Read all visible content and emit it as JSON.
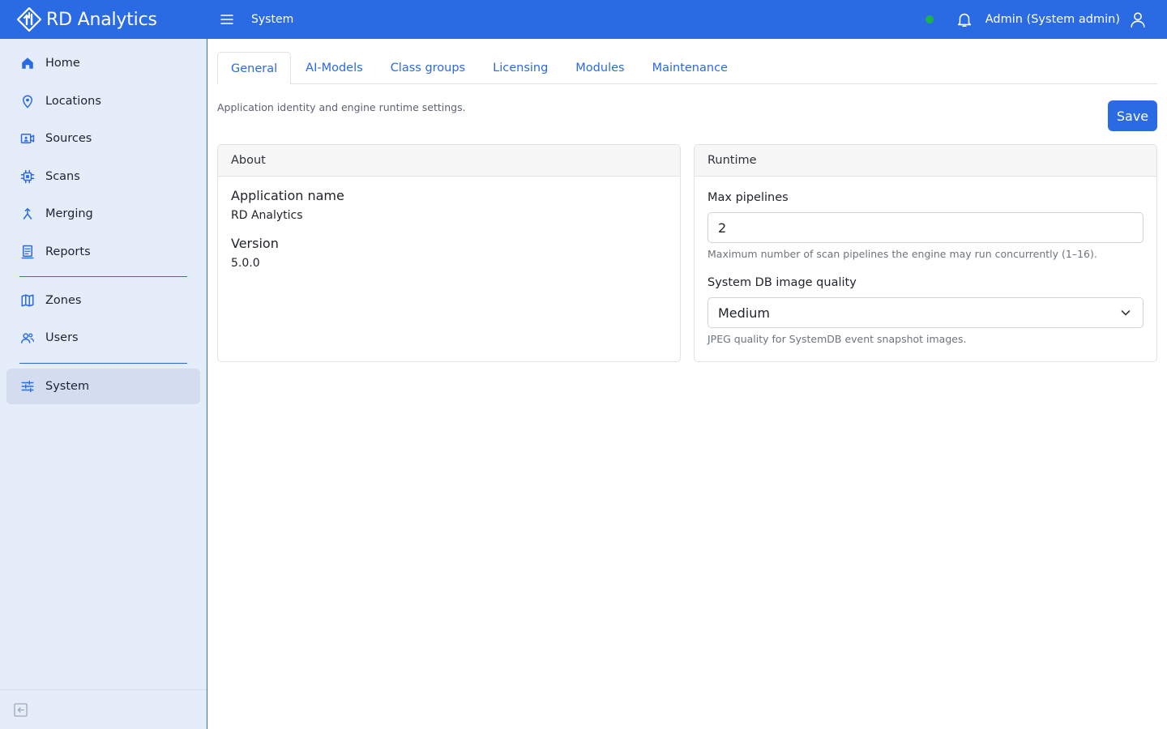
{
  "app": {
    "brand": "RD Analytics",
    "breadcrumb": "System",
    "colors": {
      "primary": "#2a6ae3",
      "sidebar_bg": "#e5edfa",
      "status_online": "#1db24a"
    }
  },
  "header": {
    "user": "Admin (System admin)",
    "icons": [
      "menu-icon",
      "bell-icon",
      "user-icon"
    ]
  },
  "sidebar": {
    "items": [
      {
        "label": "Home",
        "icon": "home-icon"
      },
      {
        "label": "Locations",
        "icon": "location-pin-icon"
      },
      {
        "label": "Sources",
        "icon": "camera-icon"
      },
      {
        "label": "Scans",
        "icon": "chip-icon"
      },
      {
        "label": "Merging",
        "icon": "merge-icon"
      },
      {
        "label": "Reports",
        "icon": "report-icon"
      },
      {
        "label": "Zones",
        "icon": "map-icon"
      },
      {
        "label": "Users",
        "icon": "users-icon"
      },
      {
        "label": "System",
        "icon": "sliders-icon",
        "active": true
      }
    ]
  },
  "tabs": [
    {
      "label": "General",
      "active": true
    },
    {
      "label": "AI-Models"
    },
    {
      "label": "Class groups"
    },
    {
      "label": "Licensing"
    },
    {
      "label": "Modules"
    },
    {
      "label": "Maintenance"
    }
  ],
  "page": {
    "description": "Application identity and engine runtime settings.",
    "save_label": "Save"
  },
  "about": {
    "title": "About",
    "app_name_label": "Application name",
    "app_name_value": "RD Analytics",
    "version_label": "Version",
    "version_value": "5.0.0"
  },
  "runtime": {
    "title": "Runtime",
    "max_pipelines_label": "Max pipelines",
    "max_pipelines_value": "2",
    "max_pipelines_help": "Maximum number of scan pipelines the engine may run concurrently (1–16).",
    "image_quality_label": "System DB image quality",
    "image_quality_value": "Medium",
    "image_quality_help": "JPEG quality for SystemDB event snapshot images."
  }
}
